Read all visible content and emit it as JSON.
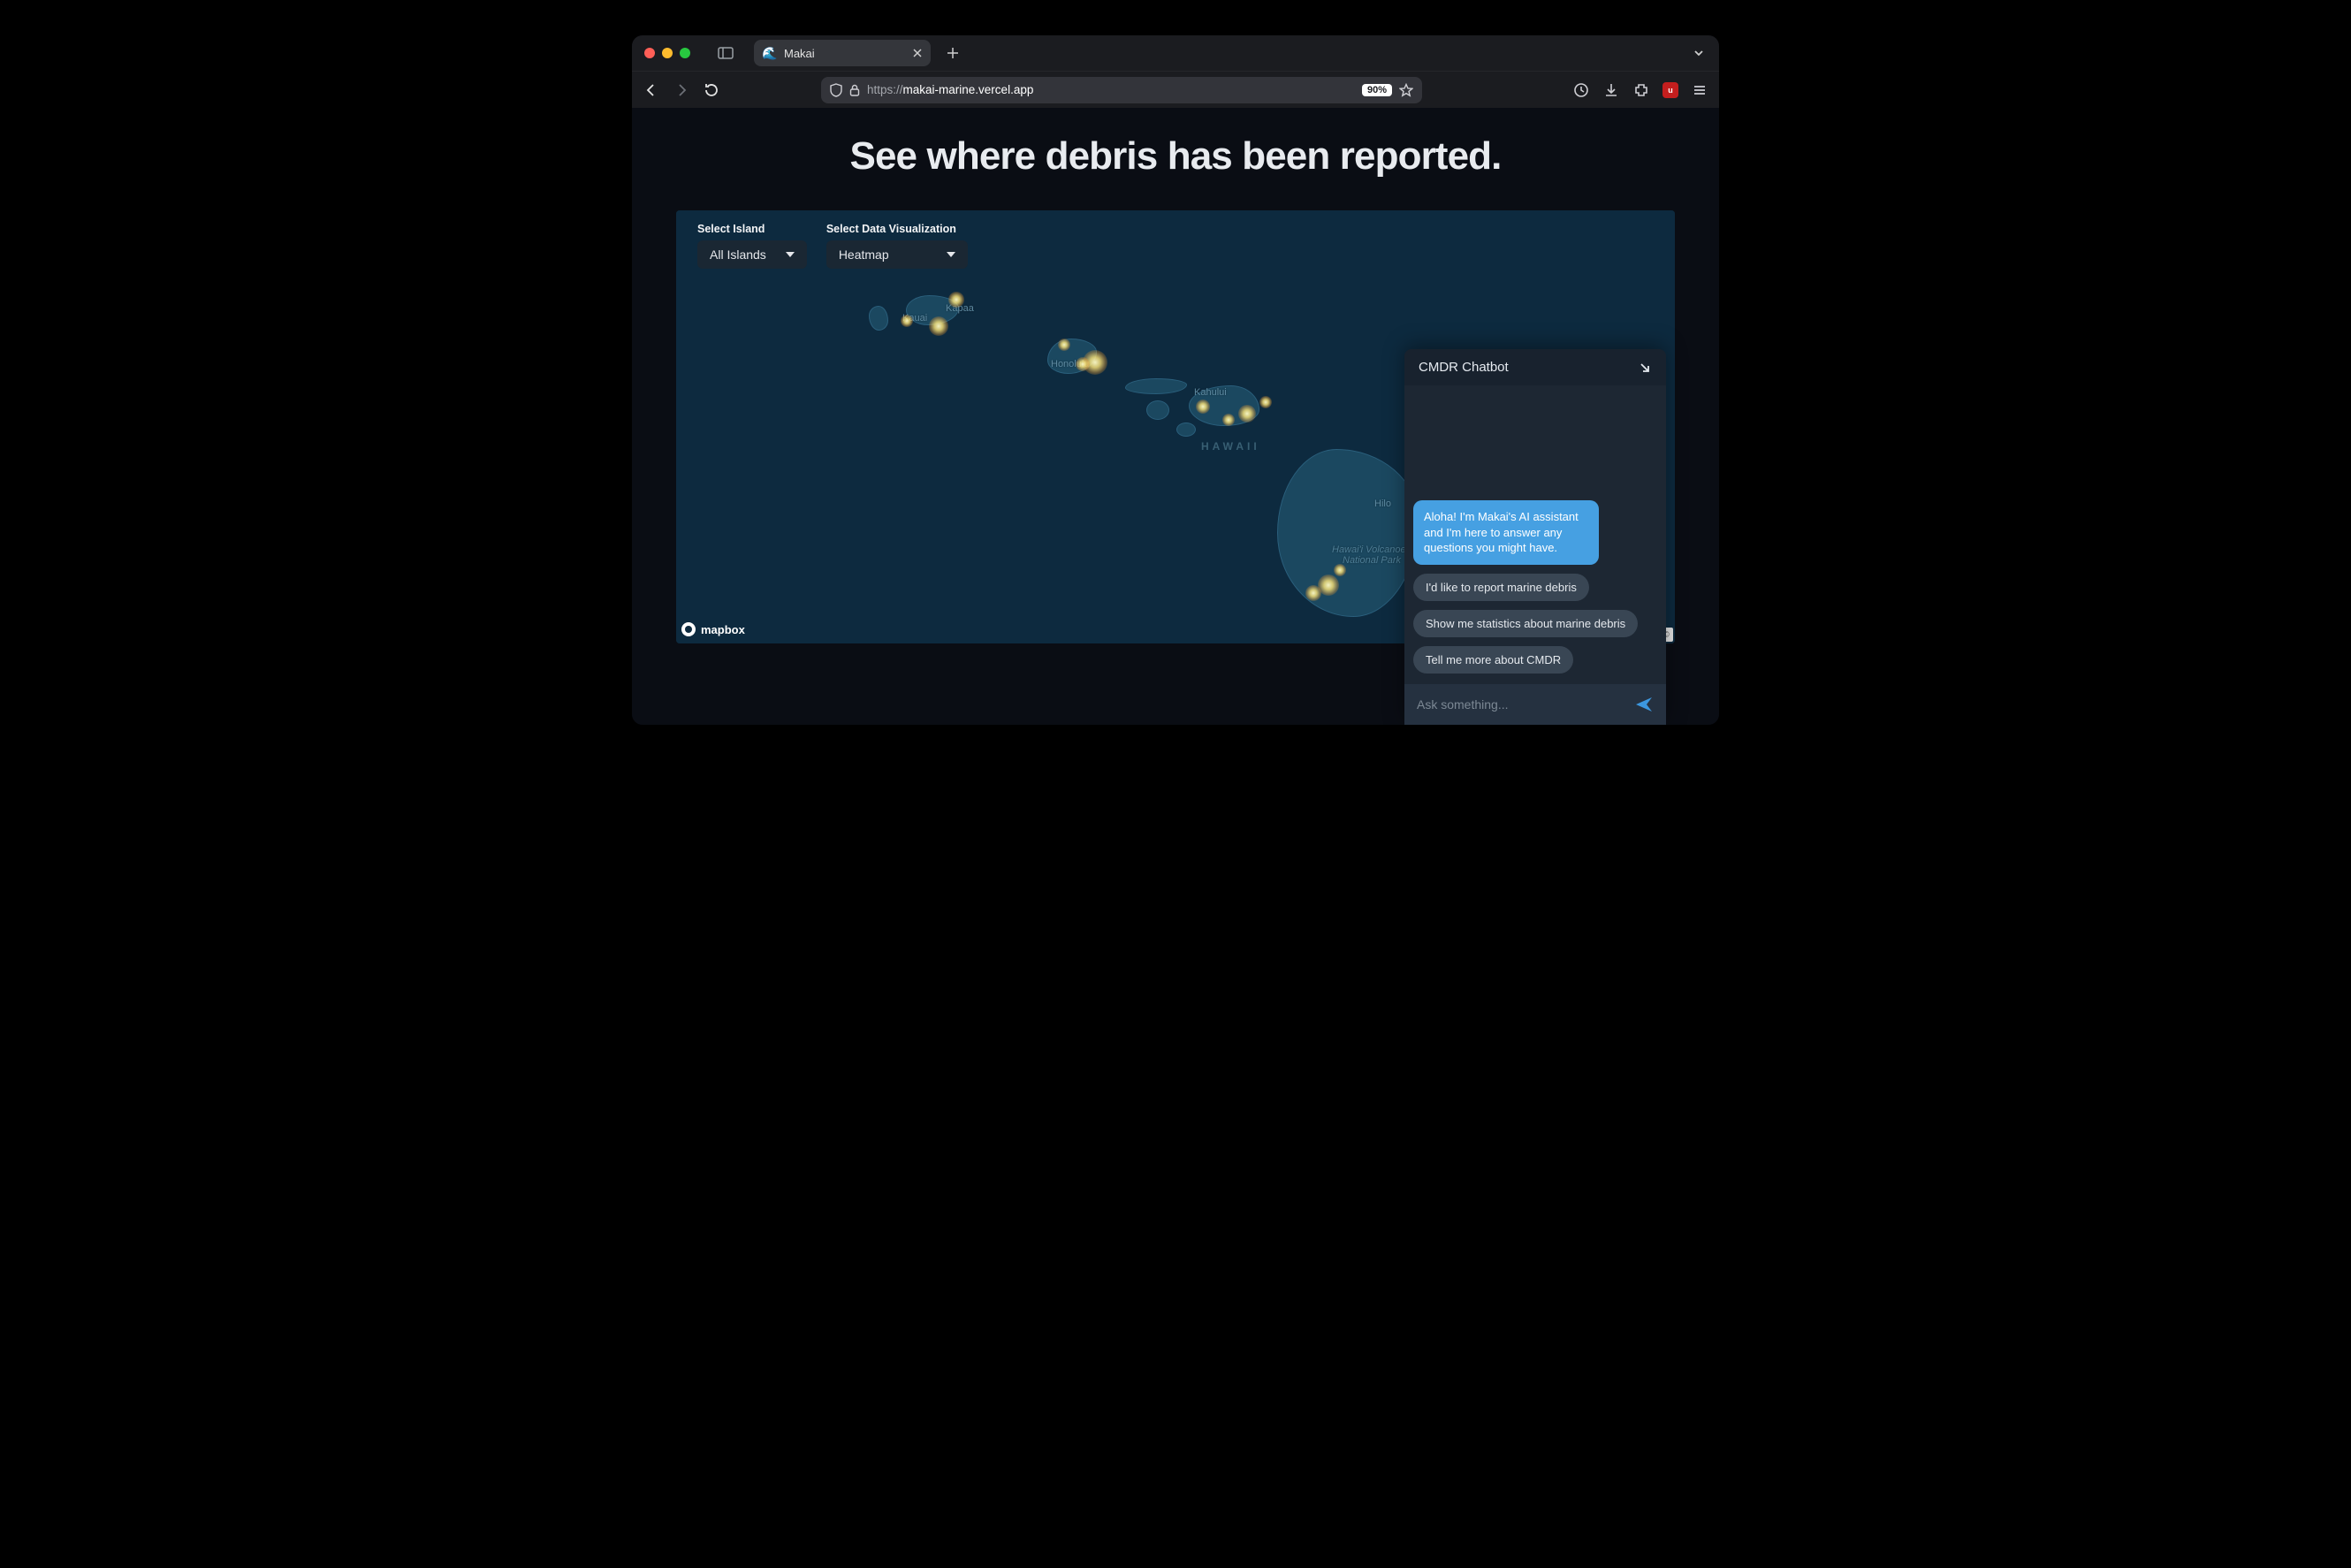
{
  "browser": {
    "tab_title": "Makai",
    "url_protocol": "https://",
    "url_rest": "makai-marine.vercel.app",
    "zoom": "90%"
  },
  "page": {
    "headline": "See where debris has been reported."
  },
  "controls": {
    "island": {
      "label": "Select Island",
      "value": "All Islands"
    },
    "viz": {
      "label": "Select Data Visualization",
      "value": "Heatmap"
    }
  },
  "map": {
    "attribution": "mapbox",
    "copyright_symbol": "©",
    "region_label": "HAWAII",
    "labels": {
      "kapaa": "Kapaa",
      "kauai": "Kauai",
      "honolulu": "Honolulu",
      "kahului": "Kahului",
      "hilo": "Hilo",
      "volcanoes1": "Hawai'i Volcanoes",
      "volcanoes2": "National Park"
    }
  },
  "chatbot": {
    "title": "CMDR Chatbot",
    "greeting": "Aloha! I'm Makai's AI assistant and I'm here to answer any questions you might have.",
    "suggestions": [
      "I'd like to report marine debris",
      "Show me statistics about marine debris",
      "Tell me more about CMDR"
    ],
    "input_placeholder": "Ask something..."
  }
}
